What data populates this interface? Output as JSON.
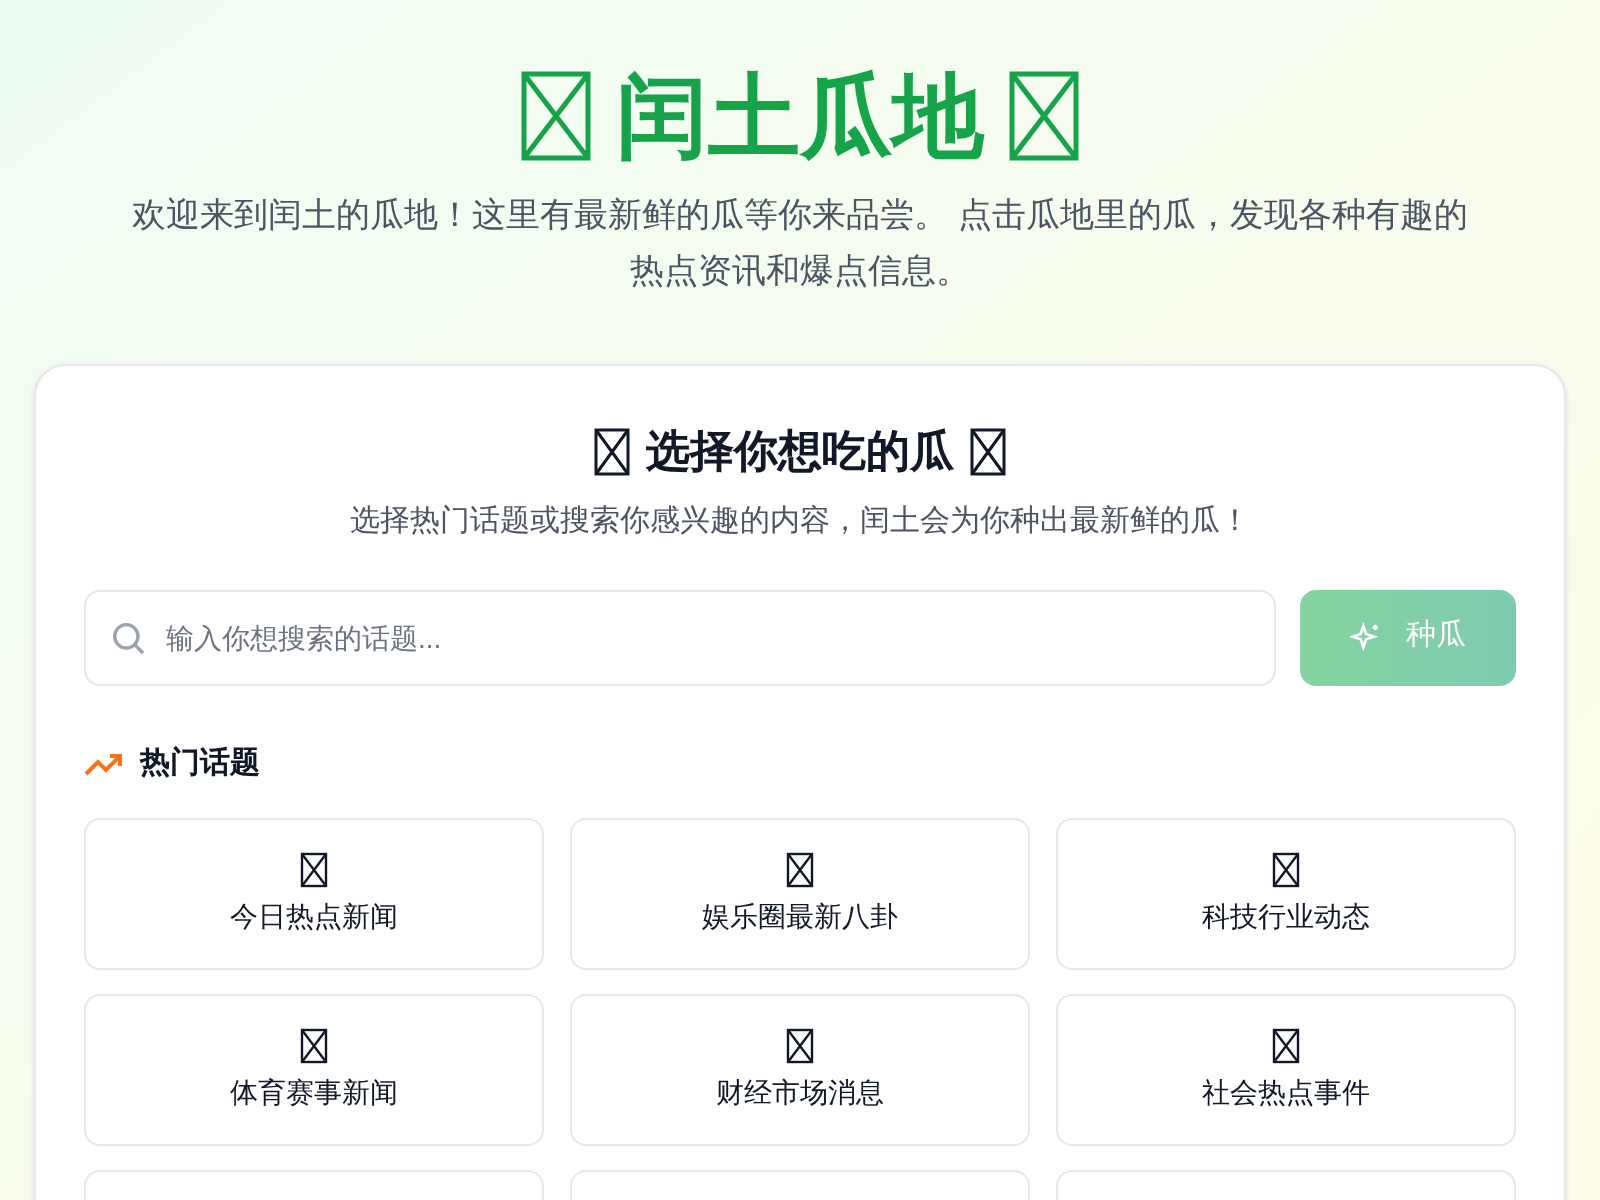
{
  "header": {
    "title": "闰土瓜地",
    "subtitle": "欢迎来到闰土的瓜地！这里有最新鲜的瓜等你来品尝。 点击瓜地里的瓜，发现各种有趣的热点资讯和爆点信息。"
  },
  "panel": {
    "title": "选择你想吃的瓜",
    "subtitle": "选择热门话题或搜索你感兴趣的内容，闰土会为你种出最新鲜的瓜！",
    "search": {
      "placeholder": "输入你想搜索的话题..."
    },
    "button": {
      "label": "种瓜",
      "disabled": true
    },
    "section_title": "热门话题",
    "topics": [
      {
        "label": "今日热点新闻"
      },
      {
        "label": "娱乐圈最新八卦"
      },
      {
        "label": "科技行业动态"
      },
      {
        "label": "体育赛事新闻"
      },
      {
        "label": "财经市场消息"
      },
      {
        "label": "社会热点事件"
      }
    ],
    "more_cards_cut_off": true
  }
}
